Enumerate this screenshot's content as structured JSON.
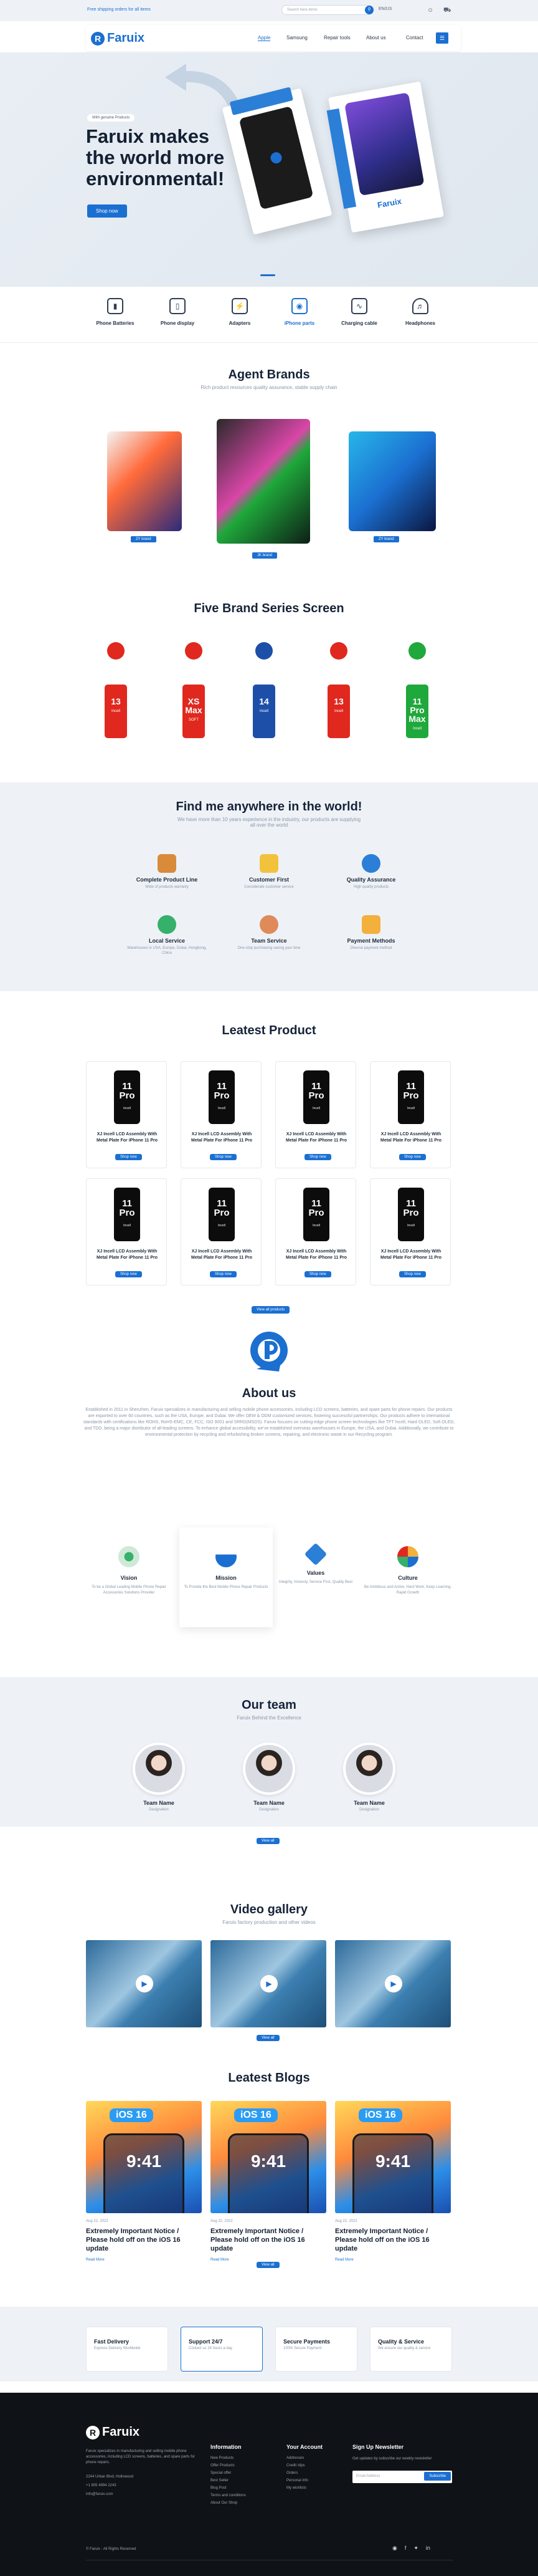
{
  "topbar": {
    "promo": "Free shipping orders for all items",
    "search_placeholder": "Search here items",
    "lang": "EN/US",
    "icons": [
      "user-icon",
      "cart-icon"
    ]
  },
  "header": {
    "logo": "Faruix",
    "nav": [
      "Apple",
      "Samsung",
      "Repair tools",
      "About us",
      "Contact"
    ]
  },
  "hero": {
    "tag": "With genuine Products",
    "title": "Faruix makes the world more environmental!",
    "button": "Shop now",
    "box_logo": "Faruix"
  },
  "categories": [
    {
      "label": "Phone Batteries",
      "icon": "battery-icon"
    },
    {
      "label": "Phone display",
      "icon": "phone-icon"
    },
    {
      "label": "Adapters",
      "icon": "adapter-icon"
    },
    {
      "label": "iPhone parts",
      "icon": "camera-icon"
    },
    {
      "label": "Charging cable",
      "icon": "cable-icon"
    },
    {
      "label": "Headphones",
      "icon": "headphones-icon"
    }
  ],
  "brands": {
    "title": "Agent Brands",
    "subtitle": "Rich product resources quality assurance, stable supply chain",
    "items": [
      "ZY brand",
      "JK brand",
      "ZY brand"
    ]
  },
  "series": {
    "title": "Five Brand Series Screen",
    "phones": [
      {
        "label": "13",
        "sub": "Incell",
        "bg": "#e0281e"
      },
      {
        "label": "XS Max",
        "sub": "SOFT",
        "bg": "#e0281e"
      },
      {
        "label": "14",
        "sub": "Incell",
        "bg": "#1e4fa8"
      },
      {
        "label": "13",
        "sub": "Incell",
        "bg": "#e0281e"
      },
      {
        "label": "11 Pro Max",
        "sub": "Incell",
        "bg": "#1fa83b"
      }
    ]
  },
  "find": {
    "title": "Find me anywhere in the world!",
    "subtitle": "We have more than 10 years experience in the industry, our products are supplying all over the world",
    "features": [
      {
        "title": "Complete Product Line",
        "desc": "Wide of products warranty"
      },
      {
        "title": "Customer First",
        "desc": "Considerate customer service"
      },
      {
        "title": "Quality Assurance",
        "desc": "High quality products"
      },
      {
        "title": "Local Service",
        "desc": "Warehouses in USA, Europe, Dubai, Hongkong, China"
      },
      {
        "title": "Team Service",
        "desc": "One-stop purchasing saving your time"
      },
      {
        "title": "Payment Methods",
        "desc": "Diverse payment method"
      }
    ]
  },
  "products": {
    "title": "Leatest Product",
    "name": "XJ Incell LCD Assembly With Metal Plate For iPhone 11 Pro",
    "phone_text": "11 Pro",
    "phone_sub": "Incell",
    "button": "Shop now",
    "more": "View all products"
  },
  "about": {
    "title": "About us",
    "text": "Established in 2011 in Shenzhen, Faruix specializes in manufacturing and selling mobile phone accessories, including LCD screens, batteries, and spare parts for phone repairs. Our products are exported to over 60 countries, such as the USA, Europe, and Dubai. We offer OEM & ODM customized services, fostering successful partnerships. Our products adhere to international standards with certifications like ROHS, RoHS-EMC, CE, FCC, ISO 9001 and SRRD(MSDS). Faruix focuses on cutting-edge phone screen technologies like TFT Incell, Hard OLED, Soft OLED, and TDD, being a major distributor of all-leading screens. To enhance global accessibility, we've established overseas warehouses in Europe, the USA, and Dubai. Additionally, we contribute to environmental protection by recycling and refurbishing broken screens, repairing, and electronic waste in our Recycling program.",
    "values": [
      {
        "title": "Vision",
        "desc": "To be a Global Leading Mobile Phone Repair Accessories Solutions Provider"
      },
      {
        "title": "Mission",
        "desc": "To Provide the Best Mobile Phone Repair Products"
      },
      {
        "title": "Values",
        "desc": "Integrity, Honesty, Service First, Quality Best"
      },
      {
        "title": "Culture",
        "desc": "Be Ambitious and Active, Hard Work, Keep Learning, Rapid Growth"
      }
    ]
  },
  "team": {
    "title": "Our team",
    "subtitle": "Faruix Behind the Excellence",
    "members": [
      {
        "name": "Team Name",
        "role": "Designation"
      },
      {
        "name": "Team Name",
        "role": "Designation"
      },
      {
        "name": "Team Name",
        "role": "Designation"
      }
    ],
    "button": "View all"
  },
  "video": {
    "title": "Video gallery",
    "subtitle": "Faruix factory production and other videos",
    "button": "View all"
  },
  "blogs": {
    "title": "Leatest Blogs",
    "items": [
      {
        "date": "Aug 22, 2022",
        "title": "Extremely Important Notice / Please hold off on the iOS 16 update",
        "more": "Read More"
      },
      {
        "date": "Aug 22, 2022",
        "title": "Extremely Important Notice / Please hold off on the iOS 16 update",
        "more": "Read More"
      },
      {
        "date": "Aug 22, 2022",
        "title": "Extremely Important Notice / Please hold off on the iOS 16 update",
        "more": "Read More"
      }
    ],
    "badge": "iOS 16",
    "time": "9:41",
    "button": "View all"
  },
  "services": [
    {
      "title": "Fast Delivery",
      "desc": "Express Delivery Worldwide"
    },
    {
      "title": "Support 24/7",
      "desc": "Contact us 24 hours a day"
    },
    {
      "title": "Secure Payments",
      "desc": "100% Secure Payment"
    },
    {
      "title": "Quality & Service",
      "desc": "We ensure our quality & service"
    }
  ],
  "footer": {
    "logo": "Faruix",
    "about": "Faruix specializes in manufacturing and selling mobile phone accessories, including LCD screens, batteries, and spare parts for phone repairs.",
    "address": "2244 Urban Blvd, Hollowood",
    "phone": "+1 805 4994 2243",
    "email": "info@faruix.com",
    "cols": [
      {
        "title": "Information",
        "items": [
          "New Products",
          "Offer Products",
          "Special offer",
          "Best Seller",
          "Blog Post",
          "Terms and conditions",
          "About Our Shop"
        ]
      },
      {
        "title": "Your Account",
        "items": [
          "Addresses",
          "Credit slips",
          "Orders",
          "Personal info",
          "My wishlists"
        ]
      }
    ],
    "newsletter_title": "Sign Up Newsletter",
    "newsletter_desc": "Get updates by subscribe our weekly newsletter",
    "email_placeholder": "Email Address",
    "subscribe": "Subscribe",
    "copyright": "© Faruix - All Rights Reserved"
  }
}
